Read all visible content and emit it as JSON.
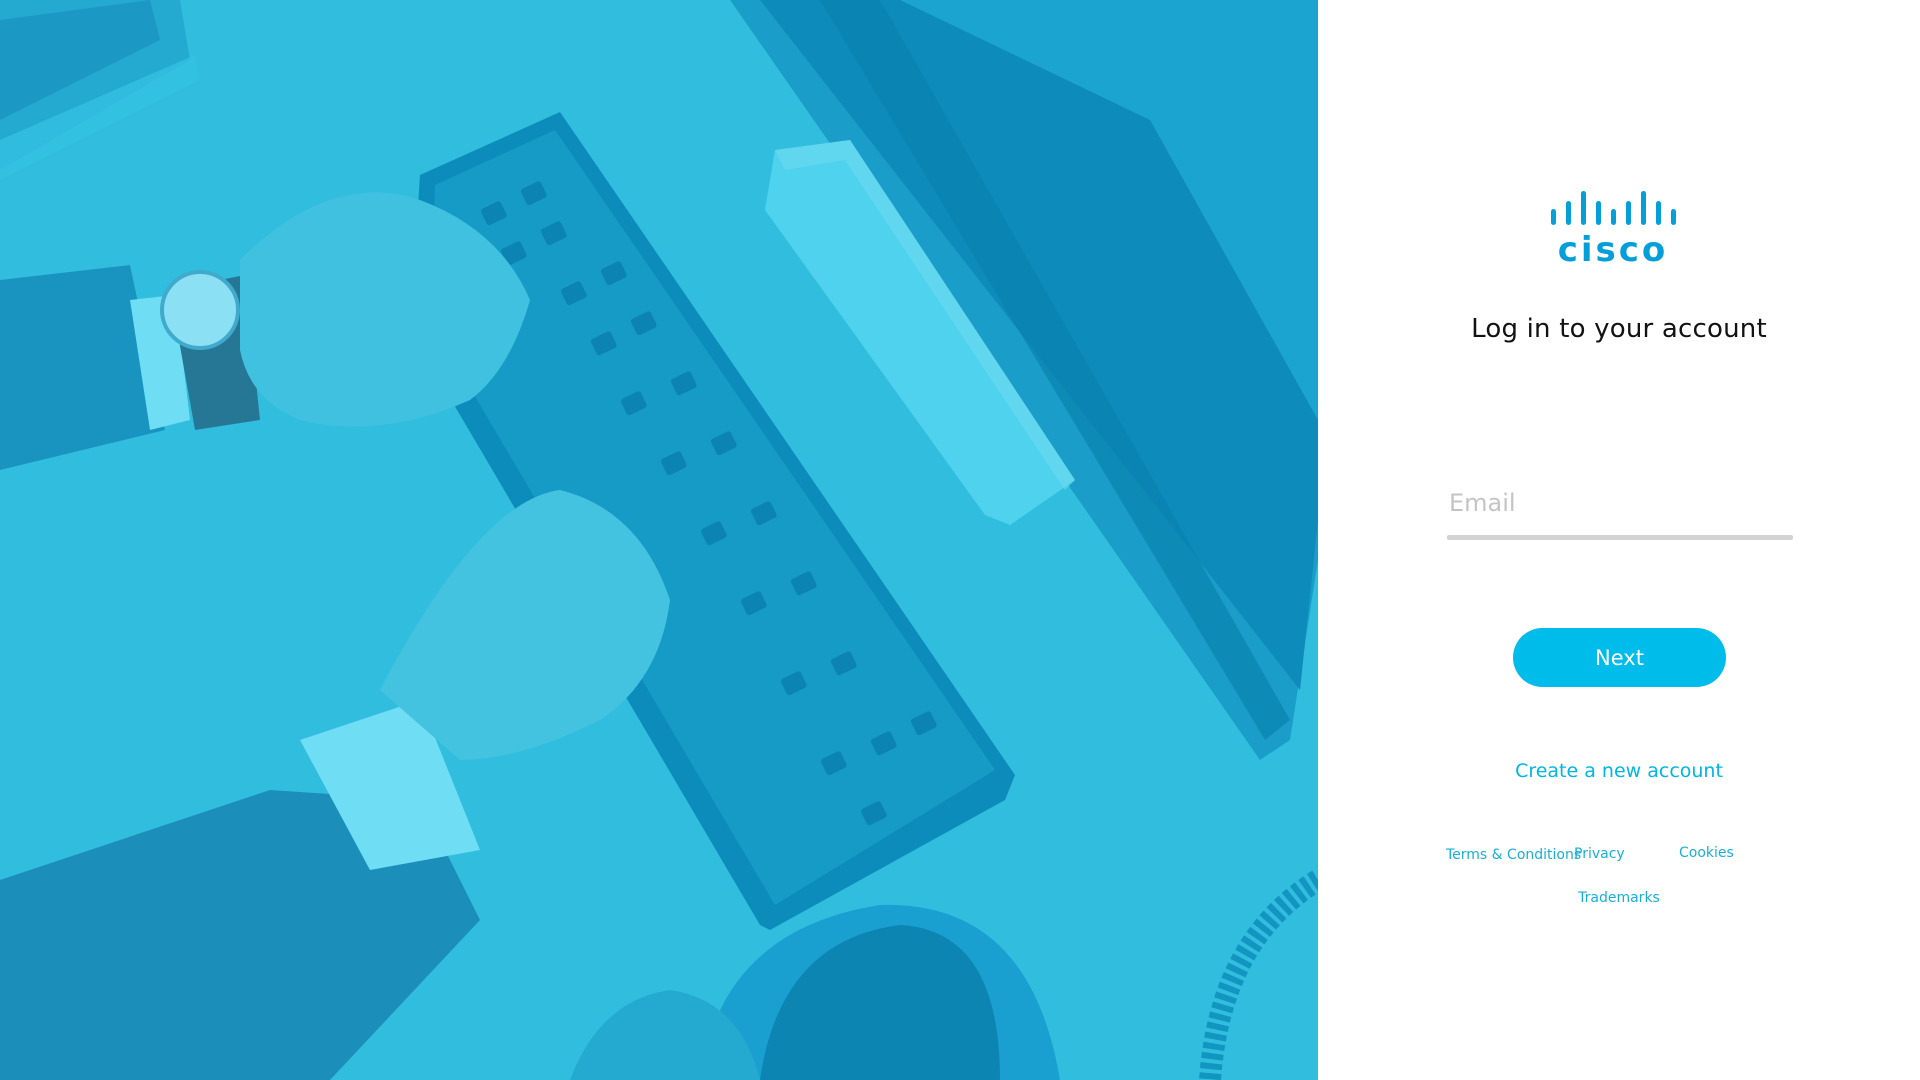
{
  "hero": {
    "background_color": "#34bcdc",
    "image_description_icon": "hands-typing-keyboard-photo"
  },
  "login": {
    "logo_text": "cisco",
    "logo_color": "#049fd9",
    "heading": "Log in to your account",
    "email_placeholder": "Email",
    "email_value": "",
    "next_label": "Next",
    "create_account_label": "Create a new account",
    "accent_color": "#00bceb"
  },
  "footer": {
    "terms": "Terms & Conditions",
    "privacy": "Privacy",
    "cookies": "Cookies",
    "trademarks": "Trademarks"
  }
}
